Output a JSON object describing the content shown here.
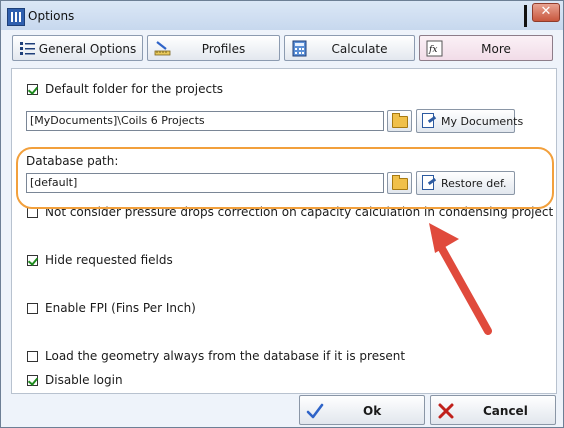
{
  "window": {
    "title": "Options",
    "close_glyph": "✕"
  },
  "tabs": [
    {
      "label": "General Options",
      "icon": "list-icon",
      "active": false
    },
    {
      "label": "Profiles",
      "icon": "ruler-pencil-icon",
      "active": false
    },
    {
      "label": "Calculate",
      "icon": "calculator-icon",
      "active": false
    },
    {
      "label": "More",
      "icon": "fx-icon",
      "active": true
    }
  ],
  "more": {
    "default_folder": {
      "checkbox_label": "Default folder for the projects",
      "checked": true,
      "value": "[MyDocuments]\\Coils 6 Projects",
      "my_documents_label": "My Documents"
    },
    "database_path": {
      "label": "Database path:",
      "value": "[default]",
      "restore_label": "Restore def."
    },
    "options": [
      {
        "label": "Not consider pressure drops correction on capacity calculation in condensing project",
        "checked": false
      },
      {
        "label": "Hide requested fields",
        "checked": true
      },
      {
        "label": "Enable FPI (Fins Per Inch)",
        "checked": false
      },
      {
        "label": "Load the geometry always from the database if it is present",
        "checked": false
      },
      {
        "label": "Disable login",
        "checked": true
      }
    ]
  },
  "footer": {
    "ok_label": "Ok",
    "cancel_label": "Cancel"
  },
  "annotation": {
    "highlight_color": "#f2a03c",
    "arrow_color": "#e04a3c"
  },
  "colors": {
    "check_green": "#1d8a1d",
    "folder_yellow": "#f0c04a",
    "cancel_red": "#c0201b",
    "ok_blue": "#2f64c8"
  }
}
